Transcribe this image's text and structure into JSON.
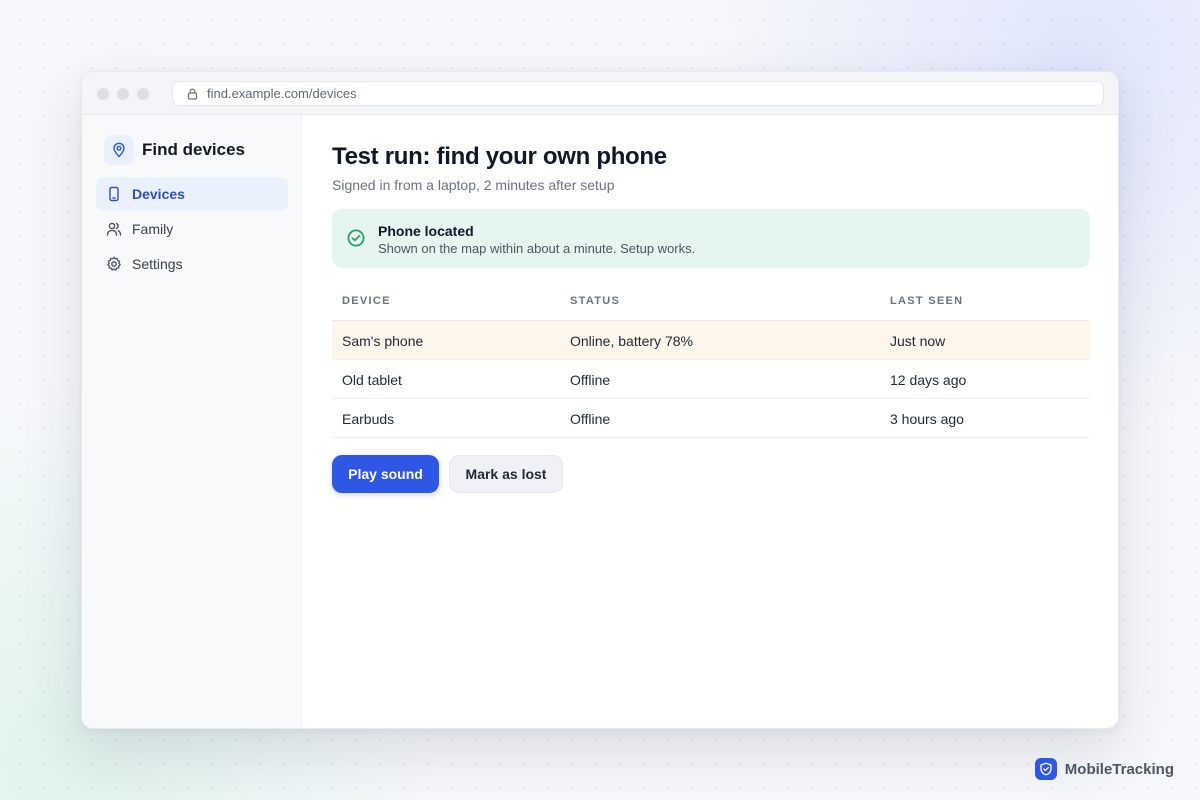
{
  "browser": {
    "url": "find.example.com/devices",
    "lock_icon": "lock-icon"
  },
  "sidebar": {
    "brand": {
      "label": "Find devices",
      "icon": "location-pin-icon"
    },
    "items": [
      {
        "label": "Devices",
        "icon": "phone-icon",
        "active": true
      },
      {
        "label": "Family",
        "icon": "users-icon",
        "active": false
      },
      {
        "label": "Settings",
        "icon": "gear-icon",
        "active": false
      }
    ]
  },
  "main": {
    "title": "Test run: find your own phone",
    "subtitle": "Signed in from a laptop, 2 minutes after setup",
    "alert": {
      "icon": "check-circle-icon",
      "title": "Phone located",
      "body": "Shown on the map within about a minute. Setup works."
    },
    "table": {
      "headers": [
        "DEVICE",
        "STATUS",
        "LAST SEEN"
      ],
      "rows": [
        [
          "Sam's phone",
          "Online, battery 78%",
          "Just now"
        ],
        [
          "Old tablet",
          "Offline",
          "12 days ago"
        ],
        [
          "Earbuds",
          "Offline",
          "3 hours ago"
        ]
      ],
      "highlighted_row": 0
    },
    "actions": {
      "primary": "Play sound",
      "secondary": "Mark as lost"
    }
  },
  "footer": {
    "brand": "MobileTracking",
    "icon": "shield-icon"
  },
  "colors": {
    "accent": "#2f57e4",
    "success_bg": "#e4f6ef",
    "success_icon": "#22a06b",
    "row_highlight": "#fef6ea"
  }
}
